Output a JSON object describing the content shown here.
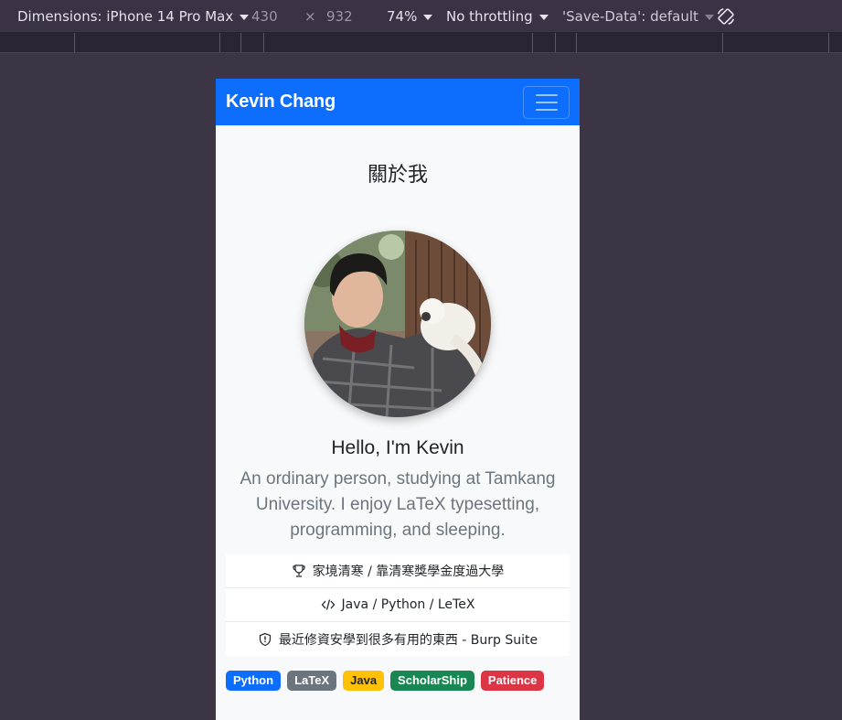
{
  "devtools": {
    "dimensions_label": "Dimensions: iPhone 14 Pro Max",
    "width": "430",
    "times": "×",
    "height": "932",
    "zoom": "74%",
    "throttling": "No throttling",
    "save_data": "'Save-Data': default",
    "rotate_icon": "rotate-icon"
  },
  "site": {
    "brand": "Kevin Chang",
    "menu_icon": "hamburger-icon",
    "section_title": "關於我",
    "hello": "Hello, I'm Kevin",
    "lead": "An ordinary person, studying at Tamkang University. I enjoy LaTeX typesetting, programming, and sleeping.",
    "list": [
      {
        "icon": "trophy-icon",
        "text": "家境清寒 / 靠清寒獎學金度過大學"
      },
      {
        "icon": "code-icon",
        "text": "Java / Python / LeTeX"
      },
      {
        "icon": "shield-icon",
        "text": "最近修資安學到很多有用的東西 - Burp Suite"
      }
    ],
    "badges": [
      {
        "label": "Python",
        "color": "#0d6efd",
        "text_color": "#ffffff"
      },
      {
        "label": "LaTeX",
        "color": "#6c757d",
        "text_color": "#ffffff"
      },
      {
        "label": "Java",
        "color": "#ffc107",
        "text_color": "#212529"
      },
      {
        "label": "ScholarShip",
        "color": "#198754",
        "text_color": "#ffffff"
      },
      {
        "label": "Patience",
        "color": "#dc3545",
        "text_color": "#ffffff"
      }
    ]
  }
}
